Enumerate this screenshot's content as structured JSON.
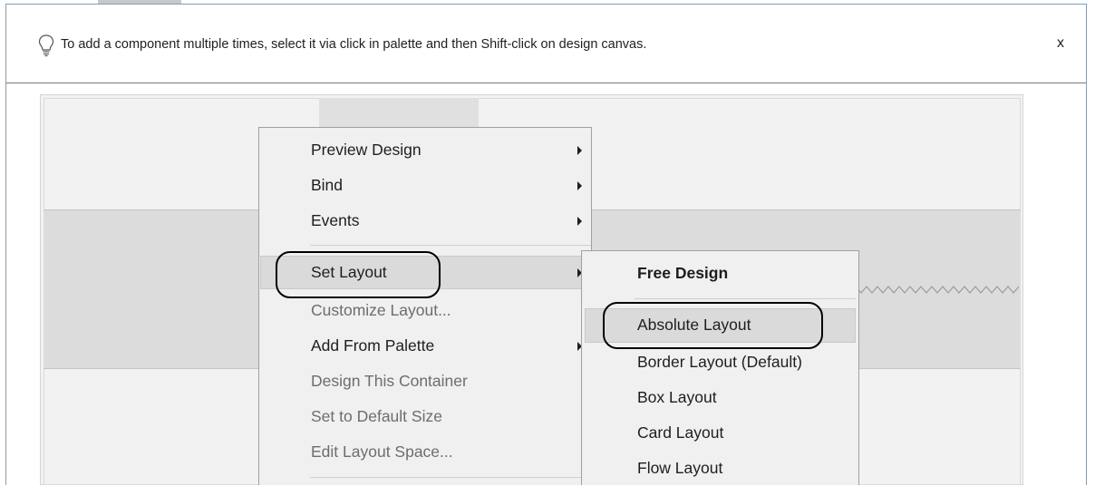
{
  "hint": {
    "text": "To add a component multiple times, select it via click in palette and then Shift-click on design canvas.",
    "close_label": "x",
    "icon": "lightbulb-icon"
  },
  "context_menu": {
    "items": [
      {
        "label": "Preview Design",
        "enabled": true,
        "submenu": true
      },
      {
        "label": "Bind",
        "enabled": true,
        "submenu": true
      },
      {
        "label": "Events",
        "enabled": true,
        "submenu": true
      },
      {
        "label": "Set Layout",
        "enabled": true,
        "submenu": true,
        "highlighted": true
      },
      {
        "label": "Customize Layout...",
        "enabled": false
      },
      {
        "label": "Add From Palette",
        "enabled": true,
        "submenu": true
      },
      {
        "label": "Design This Container",
        "enabled": false
      },
      {
        "label": "Set to Default Size",
        "enabled": false
      },
      {
        "label": "Edit Layout Space...",
        "enabled": false
      }
    ]
  },
  "layout_submenu": {
    "items": [
      {
        "label": "Free Design",
        "bold": true
      },
      {
        "label": "Absolute Layout",
        "highlighted": true
      },
      {
        "label": "Border Layout (Default)"
      },
      {
        "label": "Box Layout"
      },
      {
        "label": "Card Layout"
      },
      {
        "label": "Flow Layout"
      }
    ]
  },
  "colors": {
    "menu_bg": "#f0f0f0",
    "highlight_bg": "#dadada",
    "disabled_text": "#6d6d6d",
    "frame_border": "#7f9db9"
  }
}
